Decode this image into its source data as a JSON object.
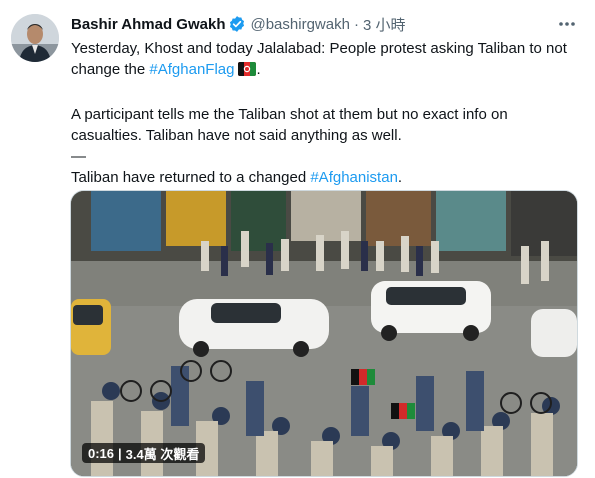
{
  "tweet": {
    "author_name": "Bashir Ahmad Gwakh",
    "handle": "@bashirgwakh",
    "separator": "·",
    "time": "3 小時",
    "line1_text": "Yesterday, Khost and today Jalalabad: People protest asking Taliban to not change the ",
    "line1_hashtag": "#AfghanFlag",
    "line1_end": ".",
    "para2": "A participant tells me the Taliban shot at them but no exact info on casualties. Taliban have not said anything as well.",
    "divider": "—",
    "line3_text": "Taliban have returned to a changed ",
    "line3_hashtag": "#Afghanistan",
    "line3_end": "."
  },
  "video": {
    "duration": "0:16",
    "views": "3.4萬 次觀看"
  },
  "colors": {
    "link": "#1d9bf0",
    "verified": "#1d9bf0",
    "muted": "#536471"
  },
  "icons": {
    "verified": "verified-badge-icon",
    "more": "more-options-icon",
    "flag": "afghanistan-flag-emoji"
  }
}
